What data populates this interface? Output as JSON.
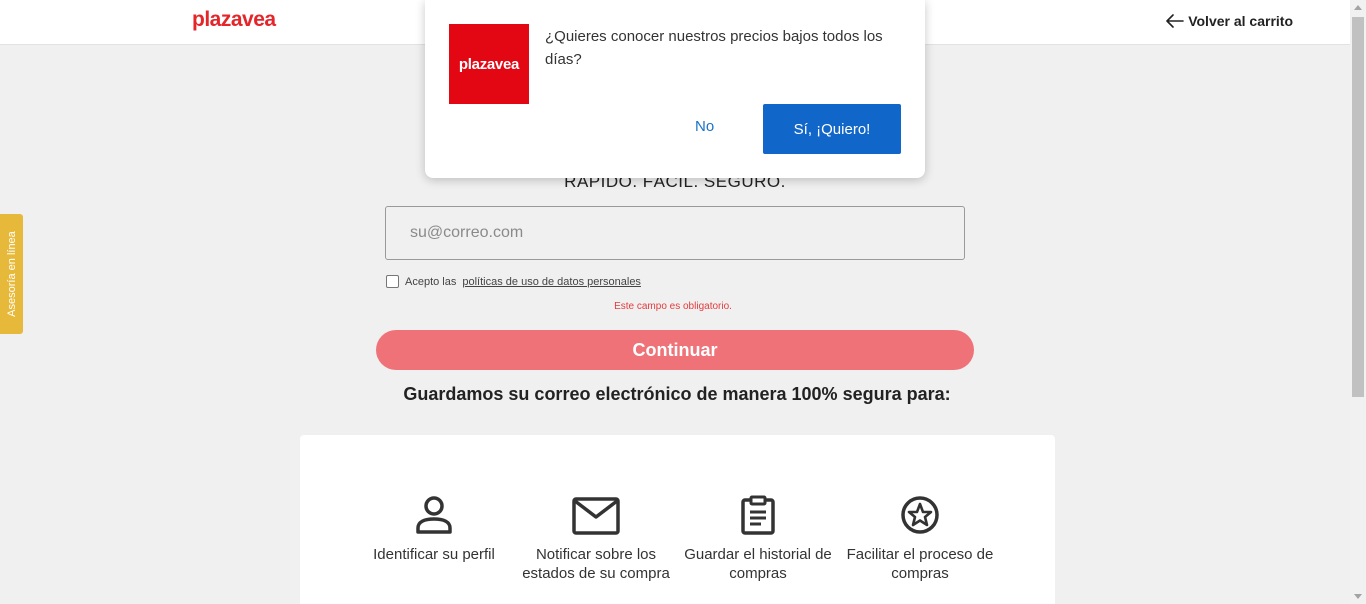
{
  "header": {
    "logo_text": "plazavea",
    "back_label": "Volver al carrito"
  },
  "side_tab": {
    "label": "Asesoría en línea"
  },
  "main": {
    "tagline": "RÁPIDO. FÁCIL. SEGURO.",
    "email_placeholder": "su@correo.com",
    "terms_prefix": "Acepto las",
    "terms_link": "políticas de uso de datos personales",
    "error_text": "Este campo es obligatorio.",
    "continue_label": "Continuar",
    "subhead": "Guardamos su correo electrónico de manera 100% segura para:"
  },
  "benefits": [
    {
      "icon": "user-icon",
      "label": "Identificar su perfil"
    },
    {
      "icon": "mail-icon",
      "label": "Notificar sobre los estados de su compra"
    },
    {
      "icon": "clipboard-icon",
      "label": "Guardar el historial de compras"
    },
    {
      "icon": "star-icon",
      "label": "Facilitar el proceso de compras"
    }
  ],
  "popup": {
    "logo_text": "plazavea",
    "message": "¿Quieres conocer nuestros precios bajos todos los días?",
    "no_label": "No",
    "yes_label": "Sí, ¡Quiero!"
  },
  "colors": {
    "brand_red": "#e4262a",
    "continue_pink": "#ef7278",
    "primary_blue": "#1167c9",
    "side_tab_yellow": "#e7b93a"
  }
}
